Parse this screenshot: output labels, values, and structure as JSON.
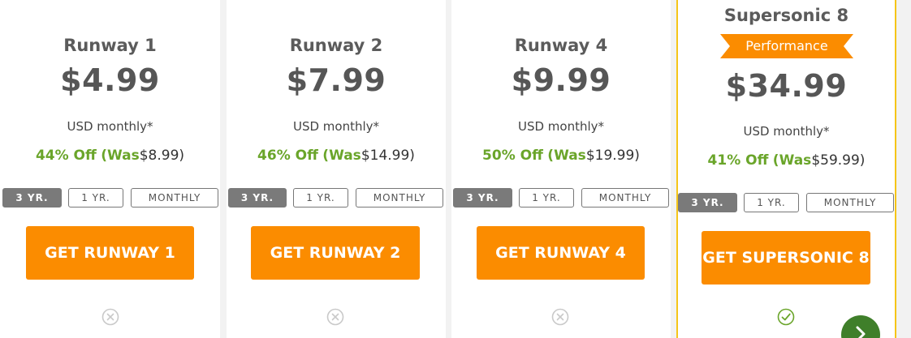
{
  "plans": [
    {
      "name": "Runway 1",
      "price": "$4.99",
      "period": "USD monthly*",
      "discount_off": "44% Off",
      "was_label": "(Was",
      "was_price": "$8.99)",
      "terms": [
        "3 YR.",
        "1 YR.",
        "MONTHLY"
      ],
      "active_term": "3 YR.",
      "cta": "GET RUNWAY 1",
      "feature_icon": "x-circle-icon"
    },
    {
      "name": "Runway 2",
      "price": "$7.99",
      "period": "USD monthly*",
      "discount_off": "46% Off",
      "was_label": "(Was",
      "was_price": "$14.99)",
      "terms": [
        "3 YR.",
        "1 YR.",
        "MONTHLY"
      ],
      "active_term": "3 YR.",
      "cta": "GET RUNWAY 2",
      "feature_icon": "x-circle-icon"
    },
    {
      "name": "Runway 4",
      "price": "$9.99",
      "period": "USD monthly*",
      "discount_off": "50% Off",
      "was_label": "(Was",
      "was_price": "$19.99)",
      "terms": [
        "3 YR.",
        "1 YR.",
        "MONTHLY"
      ],
      "active_term": "3 YR.",
      "cta": "GET RUNWAY 4",
      "feature_icon": "x-circle-icon"
    },
    {
      "name": "Supersonic 8",
      "badge": "Performance",
      "price": "$34.99",
      "period": "USD monthly*",
      "discount_off": "41% Off",
      "was_label": "(Was",
      "was_price": "$59.99)",
      "terms": [
        "3 YR.",
        "1 YR.",
        "MONTHLY"
      ],
      "active_term": "3 YR.",
      "cta": "GET SUPERSONIC 8",
      "feature_icon": "check-circle-icon"
    }
  ],
  "colors": {
    "accent_orange": "#fb8c00",
    "discount_green": "#6aa52a",
    "featured_border": "#f5c518",
    "next_button": "#3f7f2a"
  },
  "carousel": {
    "next_icon": "chevron-right-icon"
  }
}
